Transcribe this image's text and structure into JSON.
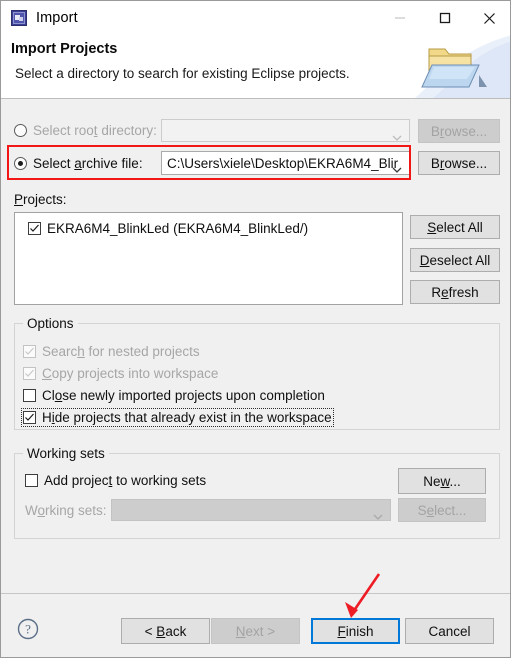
{
  "window": {
    "title": "Import",
    "icon": "eclipse-import-icon",
    "controls": {
      "minimize": {
        "name": "minimize-button",
        "enabled": false,
        "glyph": "minimize-icon"
      },
      "maximize": {
        "name": "maximize-button",
        "enabled": true,
        "glyph": "maximize-icon"
      },
      "close": {
        "name": "close-button",
        "enabled": true,
        "glyph": "close-icon"
      }
    }
  },
  "header": {
    "title": "Import Projects",
    "subtitle": "Select a directory to search for existing Eclipse projects.",
    "art_icon": "import-folder-icon"
  },
  "source": {
    "root_directory": {
      "label": "Select root directory:",
      "mnemonic": "t",
      "selected": false,
      "enabled": false,
      "combo_value": "",
      "combo_placeholder": "",
      "browse_label": "Browse...",
      "browse_enabled": false
    },
    "archive_file": {
      "label": "Select archive file:",
      "mnemonic": "a",
      "selected": true,
      "enabled": true,
      "combo_value": "C:\\Users\\xiele\\Desktop\\EKRA6M4_Blir",
      "browse_label": "Browse...",
      "browse_enabled": true
    }
  },
  "projects": {
    "label": "Projects:",
    "items": [
      {
        "checked": true,
        "label": "EKRA6M4_BlinkLed (EKRA6M4_BlinkLed/)"
      }
    ],
    "buttons": [
      {
        "name": "select-all-button",
        "label": "Select All",
        "enabled": true
      },
      {
        "name": "deselect-all-button",
        "label": "Deselect All",
        "enabled": true
      },
      {
        "name": "refresh-button",
        "label": "Refresh",
        "enabled": true
      }
    ]
  },
  "options": {
    "legend": "Options",
    "items": [
      {
        "name": "search-nested-projects-checkbox",
        "label": "Search for nested projects",
        "checked": true,
        "enabled": false,
        "focused": false
      },
      {
        "name": "copy-projects-into-workspace-checkbox",
        "label": "Copy projects into workspace",
        "checked": true,
        "enabled": false,
        "focused": false
      },
      {
        "name": "close-newly-imported-checkbox",
        "label": "Close newly imported projects upon completion",
        "checked": false,
        "enabled": true,
        "focused": false
      },
      {
        "name": "hide-existing-projects-checkbox",
        "label": "Hide projects that already exist in the workspace",
        "checked": true,
        "enabled": true,
        "focused": true
      }
    ]
  },
  "working_sets": {
    "legend": "Working sets",
    "add_checkbox": {
      "label": "Add project to working sets",
      "checked": false,
      "enabled": true
    },
    "new_button": {
      "label": "New...",
      "enabled": true
    },
    "set_label": "Working sets:",
    "set_value": "",
    "set_enabled": false,
    "select_button": {
      "label": "Select...",
      "enabled": false
    }
  },
  "footer": {
    "help_icon": "help-icon",
    "buttons": [
      {
        "name": "back-button",
        "label": "< Back",
        "enabled": true,
        "focused": false
      },
      {
        "name": "next-button",
        "label": "Next >",
        "enabled": false,
        "focused": false
      },
      {
        "name": "finish-button",
        "label": "Finish",
        "enabled": true,
        "focused": true
      },
      {
        "name": "cancel-button",
        "label": "Cancel",
        "enabled": true,
        "focused": false
      }
    ]
  },
  "annotations": {
    "highlight_color": "#f21616",
    "focus_color": "#0078d7",
    "rect_target": "archive-file-row",
    "arrow_target": "finish-button"
  }
}
